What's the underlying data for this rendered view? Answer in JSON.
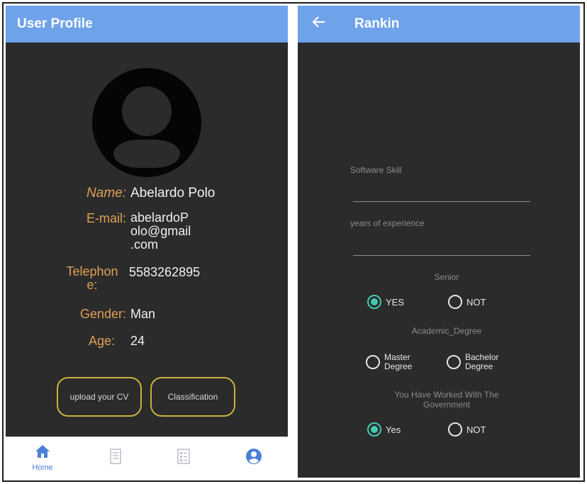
{
  "left_screen": {
    "title": "User Profile",
    "profile": {
      "name_label": "Name:",
      "name_value": "Abelardo Polo",
      "email_label": "E-mail:",
      "email_value": [
        "abelardoP",
        "olo@gmail",
        ".com"
      ],
      "telephone_label": [
        "Telephon",
        "e:"
      ],
      "telephone_value": "5583262895",
      "gender_label": "Gender:",
      "gender_value": "Man",
      "age_label": "Age:",
      "age_value": "24"
    },
    "buttons": {
      "upload_cv": "upload your CV",
      "classification": "Classification"
    },
    "bottom_nav": {
      "items": [
        {
          "label": "Home",
          "icon": "home-icon",
          "active": true
        },
        {
          "label": "",
          "icon": "document-icon",
          "active": false
        },
        {
          "label": "",
          "icon": "checklist-icon",
          "active": false
        },
        {
          "label": "",
          "icon": "account-circle-icon",
          "active": false
        }
      ]
    }
  },
  "right_screen": {
    "title": "Rankin",
    "back_icon": "arrow-left-icon",
    "fields": {
      "software_skill_placeholder": "Software Skill",
      "experience_placeholder": "years of experience"
    },
    "senior": {
      "label": "Senior",
      "options": [
        "YES",
        "NOT"
      ],
      "selected": "YES"
    },
    "academic_degree": {
      "label": "Academic_Degree",
      "options": [
        [
          "Master",
          "Degree"
        ],
        [
          "Bachelor",
          "Degree"
        ]
      ],
      "selected": null
    },
    "government": {
      "label": [
        "You Have Worked With The",
        "Government"
      ],
      "options": [
        "Yes",
        "NOT"
      ],
      "selected": "Yes"
    }
  },
  "colors": {
    "app_bar": "#6ea2e9",
    "background": "#2b2b2b",
    "label_accent": "#e0a055",
    "button_border": "#c9b23e",
    "radio_selected": "#45c9b2",
    "nav_active": "#4a7fd6"
  }
}
